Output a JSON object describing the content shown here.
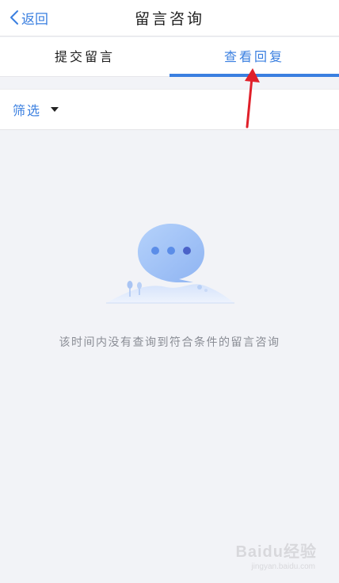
{
  "navbar": {
    "back_label": "返回",
    "title": "留言咨询"
  },
  "tabs": [
    {
      "label": "提交留言",
      "active": false
    },
    {
      "label": "查看回复",
      "active": true
    }
  ],
  "filter": {
    "label": "筛选"
  },
  "empty_state": {
    "message": "该时间内没有查询到符合条件的留言咨询",
    "icon": "chat-bubble-illustration"
  },
  "watermark": {
    "brand": "Baidu经验",
    "url": "jingyan.baidu.com"
  },
  "colors": {
    "accent": "#3a7fe0",
    "annotation_arrow": "#e0202a",
    "background": "#f2f3f7"
  }
}
